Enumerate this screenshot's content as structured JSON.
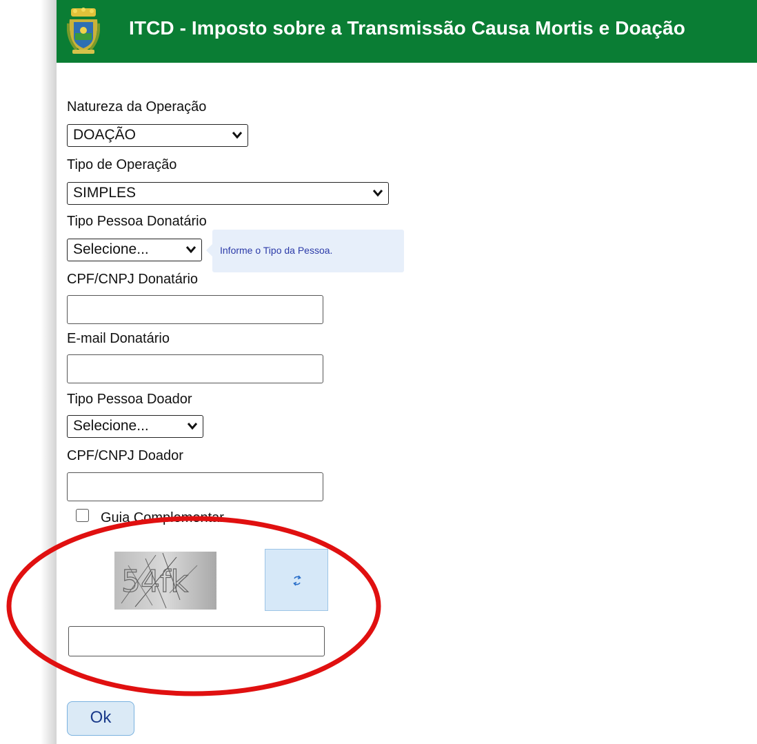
{
  "header": {
    "title": "ITCD - Imposto sobre a Transmissão Causa Mortis e Doação",
    "background_color": "#0a7d34"
  },
  "form": {
    "natureza_label": "Natureza da Operação",
    "natureza_value": "DOAÇÃO",
    "tipo_operacao_label": "Tipo de Operação",
    "tipo_operacao_value": "SIMPLES",
    "tipo_pessoa_donatario_label": "Tipo Pessoa Donatário",
    "tipo_pessoa_donatario_value": "Selecione...",
    "tooltip_text": "Informe o Tipo da Pessoa.",
    "cpf_cnpj_donatario_label": "CPF/CNPJ Donatário",
    "cpf_cnpj_donatario_value": "",
    "email_donatario_label": "E-mail Donatário",
    "email_donatario_value": "",
    "tipo_pessoa_doador_label": "Tipo Pessoa Doador",
    "tipo_pessoa_doador_value": "Selecione...",
    "cpf_cnpj_doador_label": "CPF/CNPJ Doador",
    "cpf_cnpj_doador_value": "",
    "guia_complementar_label": "Guia Complementar",
    "guia_complementar_checked": false
  },
  "captcha": {
    "text": "54fk",
    "refresh_icon": "refresh-icon",
    "input_value": ""
  },
  "ok_button": {
    "label": "Ok"
  },
  "annotation": {
    "color": "#e01010"
  }
}
